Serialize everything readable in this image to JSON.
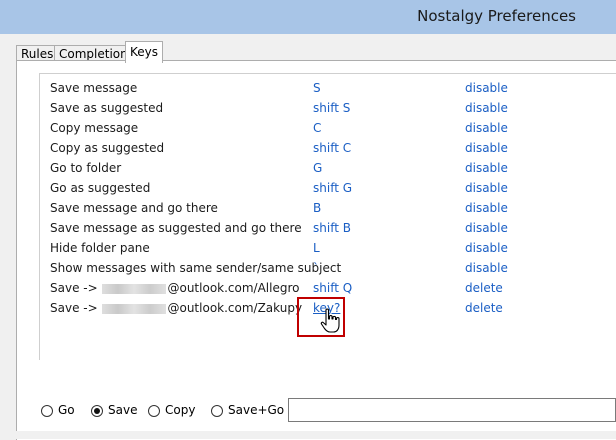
{
  "window": {
    "title": "Nostalgy Preferences"
  },
  "tabs": [
    {
      "label": "Rules",
      "active": false
    },
    {
      "label": "Completion",
      "active": false
    },
    {
      "label": "Keys",
      "active": true
    }
  ],
  "keys": [
    {
      "action": "Save message",
      "key": "S",
      "toggle": "disable"
    },
    {
      "action": "Save as suggested",
      "key": "shift S",
      "toggle": "disable"
    },
    {
      "action": "Copy message",
      "key": "C",
      "toggle": "disable"
    },
    {
      "action": "Copy as suggested",
      "key": "shift C",
      "toggle": "disable"
    },
    {
      "action": "Go to folder",
      "key": "G",
      "toggle": "disable"
    },
    {
      "action": "Go as suggested",
      "key": "shift G",
      "toggle": "disable"
    },
    {
      "action": "Save message and go there",
      "key": "B",
      "toggle": "disable"
    },
    {
      "action": "Save message as suggested and go there",
      "key": "shift B",
      "toggle": "disable"
    },
    {
      "action": "Hide folder pane",
      "key": "L",
      "toggle": "disable"
    },
    {
      "action": "Show messages with same sender/same subject",
      "key": "`",
      "toggle": "disable"
    },
    {
      "action_prefix": "Save ->",
      "action_suffix": "@outlook.com/Allegro",
      "key": "shift Q",
      "toggle": "delete"
    },
    {
      "action_prefix": "Save ->",
      "action_suffix": "@outlook.com/Zakupy",
      "key": "key?",
      "toggle": "delete"
    }
  ],
  "bottom": {
    "options": [
      {
        "label": "Go",
        "checked": false
      },
      {
        "label": "Save",
        "checked": true
      },
      {
        "label": "Copy",
        "checked": false
      },
      {
        "label": "Save+Go",
        "checked": false
      }
    ],
    "input_value": ""
  },
  "colors": {
    "titlebar": "#a8c5e7",
    "link": "#1a5ec4",
    "highlight": "#c00000"
  }
}
